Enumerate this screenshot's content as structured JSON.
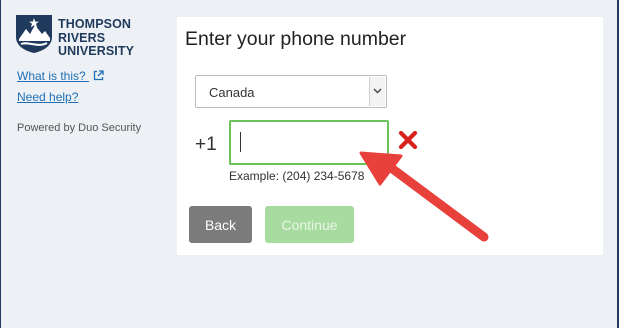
{
  "sidebar": {
    "logo_lines": [
      "THOMPSON",
      "RIVERS",
      "UNIVERSITY"
    ],
    "what_is_this": "What is this?",
    "need_help": "Need help?",
    "powered_by": "Powered by Duo Security"
  },
  "main": {
    "title": "Enter your phone number",
    "country": {
      "selected": "Canada"
    },
    "phone": {
      "prefix": "+1",
      "value": "",
      "example": "Example: (204) 234-5678",
      "status": "invalid"
    },
    "buttons": {
      "back": "Back",
      "continue": "Continue"
    }
  },
  "colors": {
    "brand_navy": "#1f3a5c",
    "link_blue": "#1e6fb7",
    "input_border_green": "#6ac259",
    "error_red": "#d9201b",
    "back_button": "#7b7b7b",
    "continue_disabled": "#a8dba0",
    "annotation_arrow": "#e8413c"
  },
  "icons": {
    "external_link": "external-link-icon",
    "dropdown": "chevron-down-icon",
    "error": "error-x-icon",
    "annotation": "red-arrow-pointer"
  }
}
